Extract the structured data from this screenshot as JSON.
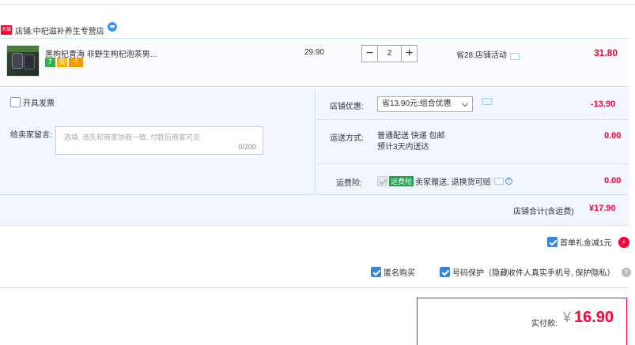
{
  "store": {
    "tag": "天猫",
    "label": "店铺:",
    "name": "中杞滋补养生专营店"
  },
  "item": {
    "title": "黑枸杞青海 非野生枸杞泡茶男...",
    "badges": [
      "7",
      "保",
      "卡"
    ],
    "price": "29.90",
    "qty_minus": "−",
    "qty_value": "2",
    "qty_plus": "+",
    "promo": "省28:店铺活动",
    "total": "31.80"
  },
  "invoice": {
    "label": "开具发票",
    "checked": false
  },
  "note": {
    "label": "给卖家留言:",
    "placeholder": "选填, 请先和商家协商一致, 付款后商家可见",
    "count": "0/200"
  },
  "discount": {
    "label": "店铺优惠:",
    "selected": "省13.90元:组合优惠",
    "value": "-13.90"
  },
  "shipping": {
    "label": "运送方式:",
    "line1": "普通配送 快递 包邮",
    "line2": "预计3天内送达",
    "value": "0.00"
  },
  "insurance": {
    "label": "运费险:",
    "tag": "运费险",
    "text": "卖家赠送, 退换货可赔",
    "value": "0.00"
  },
  "store_total": {
    "label": "店铺合计(含运费)",
    "value": "¥17.90"
  },
  "gift": {
    "label": "首单礼金减1元",
    "checked": true,
    "icon": "⚡"
  },
  "anonymous": {
    "label": "匿名购买",
    "checked": true
  },
  "privacy": {
    "label": "号码保护（隐藏收件人真实手机号, 保护隐私）",
    "checked": true,
    "help": "?"
  },
  "payment": {
    "label": "实付款:",
    "symbol": "¥",
    "value": "16.90"
  },
  "colors": {
    "accent": "#ff0036",
    "panel": "#f2f7ff",
    "checkbox": "#3a84d8"
  }
}
